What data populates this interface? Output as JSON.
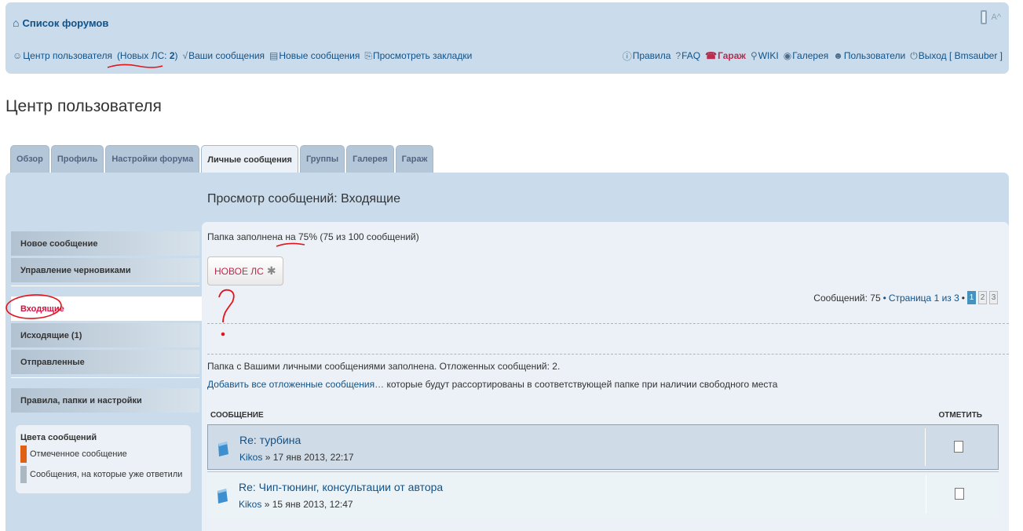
{
  "header": {
    "forum_list": "Список форумов",
    "font_size": "A^",
    "nav_left": {
      "ucp": "Центр пользователя",
      "new_pm_open": "(Новых ЛС:",
      "new_pm_count": "2",
      "new_pm_close": ")",
      "your_posts": "Ваши сообщения",
      "new_posts": "Новые сообщения",
      "bookmarks": "Просмотреть закладки"
    },
    "nav_right": {
      "rules": "Правила",
      "faq": "FAQ",
      "garage": "Гараж",
      "wiki": "WIKI",
      "gallery": "Галерея",
      "members": "Пользователи",
      "logout": "Выход [ Bmsauber ]"
    }
  },
  "page_title": "Центр пользователя",
  "tabs": [
    "Обзор",
    "Профиль",
    "Настройки форума",
    "Личные сообщения",
    "Группы",
    "Галерея",
    "Гараж"
  ],
  "sidebar": {
    "compose": "Новое сообщение",
    "drafts": "Управление черновиками",
    "inbox": "Входящие",
    "outbox": "Исходящие (1)",
    "sent": "Отправленные",
    "rules": "Правила, папки и настройки",
    "legend_title": "Цвета сообщений",
    "legend_marked": "Отмеченное сообщение",
    "legend_replied": "Сообщения, на которые уже ответили",
    "colors": {
      "marked": "#e06014",
      "replied": "#a9b8c2"
    }
  },
  "main": {
    "title": "Просмотр сообщений: Входящие",
    "quota_prefix": "Папка заполнена на",
    "quota_percent": "75%",
    "quota_suffix": "(75 из 100 сообщений)",
    "new_pm_button": "НОВОЕ ЛС",
    "pagination": {
      "count": "Сообщений: 75",
      "page": "Страница 1 из 3",
      "pages": [
        "1",
        "2",
        "3"
      ],
      "current": 1
    },
    "info_line": "Папка с Вашими личными сообщениями заполнена. Отложенных сообщений: 2.",
    "info_link": "Добавить все отложенные сообщения…",
    "info_rest": "которые будут рассортированы в соответствующей папке при наличии свободного места",
    "col_message": "Сообщение",
    "col_mark": "Отметить",
    "messages": [
      {
        "title": "Re: турбина",
        "author": "Kikos",
        "date": "» 17 янв 2013, 22:17"
      },
      {
        "title": "Re: Чип-тюнинг, консультации от автора",
        "author": "Kikos",
        "date": "» 15 янв 2013, 12:47"
      }
    ]
  }
}
